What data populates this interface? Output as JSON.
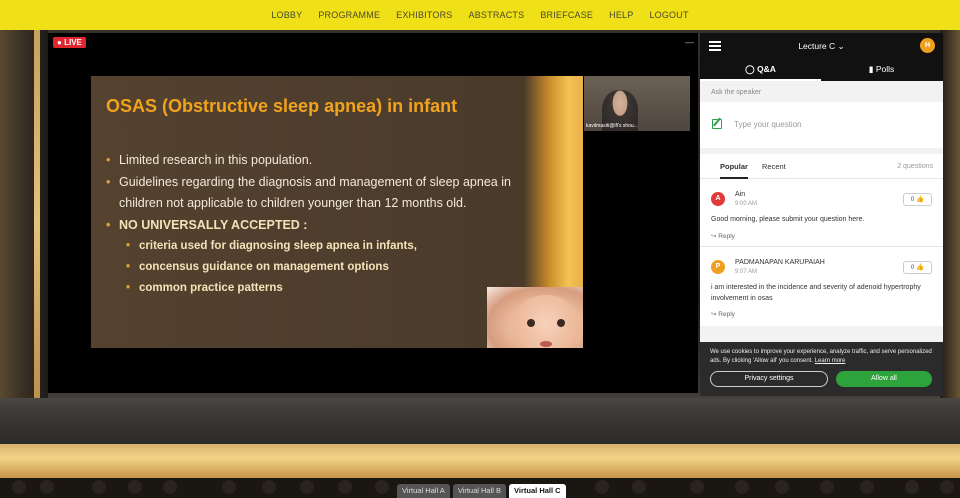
{
  "nav": {
    "items": [
      "LOBBY",
      "PROGRAMME",
      "EXHIBITORS",
      "ABSTRACTS",
      "BRIEFCASE",
      "HELP",
      "LOGOUT"
    ]
  },
  "video": {
    "live_label": "LIVE",
    "speaker_name": "kavitmasiti@ifi's shou...",
    "slide": {
      "title": "OSAS (Obstructive sleep apnea) in infant",
      "bullets": [
        "Limited research in this population.",
        "Guidelines regarding the diagnosis and management of sleep apnea in children not applicable to children younger than 12 months old.",
        "NO UNIVERSALLY ACCEPTED :"
      ],
      "sub_bullets": [
        "criteria used for diagnosing sleep apnea in infants,",
        "concensus guidance on management options",
        "common practice patterns"
      ]
    }
  },
  "panel": {
    "lecture_title": "Lecture C",
    "user_initial": "H",
    "tabs": {
      "qa": "Q&A",
      "polls": "Polls"
    },
    "ask_label": "Ask the speaker",
    "question_placeholder": "Type your question",
    "sort": {
      "popular": "Popular",
      "recent": "Recent",
      "count": "2 questions"
    },
    "questions": [
      {
        "initial": "A",
        "color": "#e03a3a",
        "name": "Ain",
        "time": "9:00 AM",
        "text": "Good morning, please submit your question here.",
        "likes": "0",
        "reply": "Reply"
      },
      {
        "initial": "P",
        "color": "#f0a020",
        "name": "PADMANAPAN KARUPAIAH",
        "time": "9:07 AM",
        "text": "i am interested in the incidence and severity of adenoid hypertrophy involvement in osas",
        "likes": "0",
        "reply": "Reply"
      }
    ]
  },
  "cookie": {
    "text": "We use cookies to improve your experience, analyze traffic, and serve personalized ads. By clicking 'Allow all' you consent.",
    "learn_more": "Learn more",
    "privacy_settings": "Privacy settings",
    "allow_all": "Allow all"
  },
  "halls": [
    "Virtual Hall A",
    "Virtual Hall B",
    "Virtual Hall C"
  ]
}
